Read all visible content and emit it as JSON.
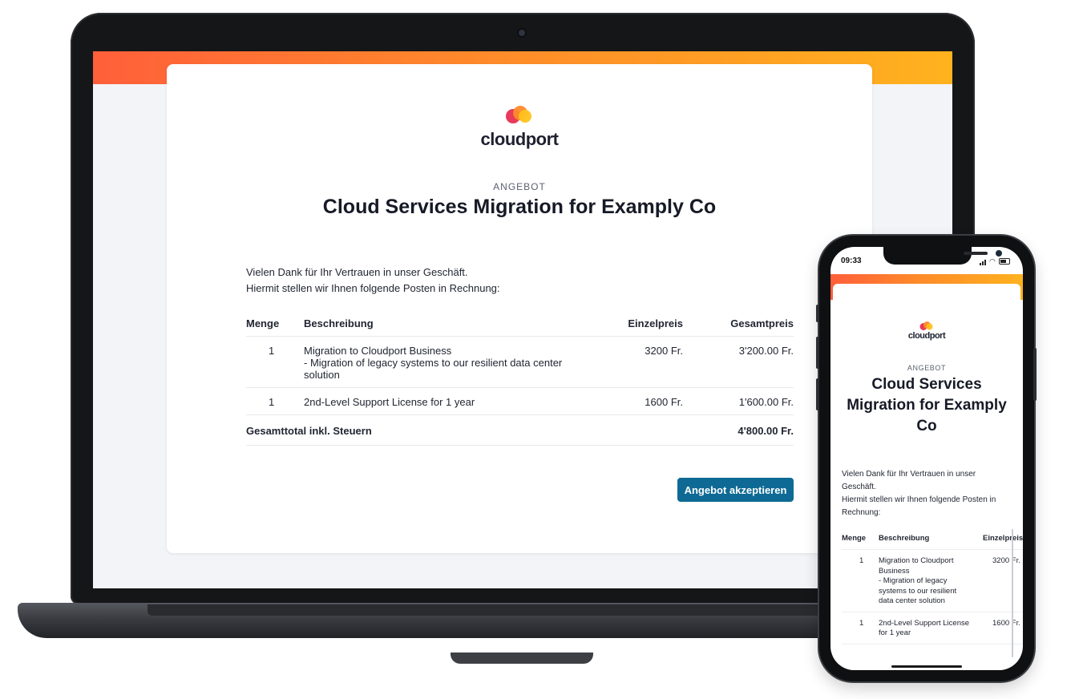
{
  "brand": {
    "name": "cloudport",
    "colors": {
      "accent": "#0e6a95",
      "gradient_start": "#ff5f3a",
      "gradient_end": "#ffb21e",
      "logo_red": "#e83a5a",
      "logo_orange": "#ff8a2a",
      "logo_yellow": "#ffc21e"
    }
  },
  "document": {
    "eyebrow": "ANGEBOT",
    "title": "Cloud Services Migration for Examply Co",
    "intro_line_1": "Vielen Dank für Ihr Vertrauen in unser Geschäft.",
    "intro_line_2": "Hiermit stellen wir Ihnen folgende Posten in Rechnung:",
    "table": {
      "headers": {
        "qty": "Menge",
        "description": "Beschreibung",
        "unit_price": "Einzelpreis",
        "total_price": "Gesamtpreis"
      },
      "rows": [
        {
          "qty": "1",
          "description": "Migration to Cloudport Business\n- Migration of legacy systems to our resilient data center solution",
          "unit_price": "3200 Fr.",
          "total_price": "3'200.00 Fr."
        },
        {
          "qty": "1",
          "description": "2nd-Level Support License for 1 year",
          "unit_price": "1600 Fr.",
          "total_price": "1'600.00 Fr."
        }
      ],
      "total_label": "Gesamttotal inkl. Steuern",
      "total_value": "4'800.00 Fr."
    },
    "accept_button": "Angebot akzeptieren"
  },
  "phone": {
    "time": "09:33",
    "wifi_icon": "wifi-icon",
    "intro_line_1": "Vielen Dank für Ihr Vertrauen in unser Geschäft.",
    "intro_line_2": "Hiermit stellen wir Ihnen folgende Posten in Rechnung:",
    "headers": {
      "qty": "Menge",
      "description": "Beschreibung",
      "unit_price": "Einzelpreis"
    },
    "rows": [
      {
        "qty": "1",
        "description": "Migration to Cloudport Business\n- Migration of legacy systems to our resilient data center solution",
        "unit_price": "3200 Fr."
      },
      {
        "qty": "1",
        "description": "2nd-Level Support License for 1 year",
        "unit_price": "1600 Fr."
      }
    ]
  }
}
